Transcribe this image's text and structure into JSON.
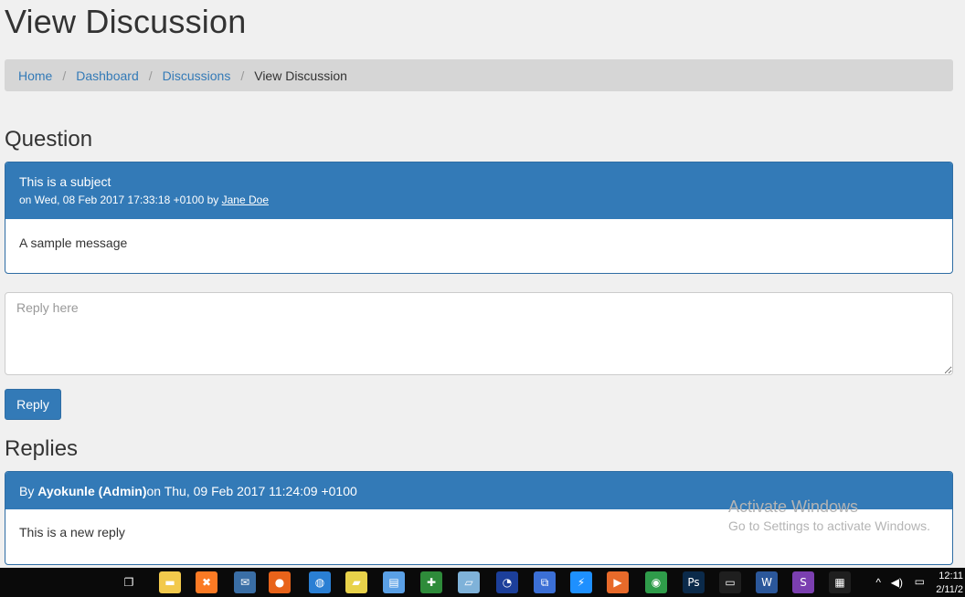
{
  "page": {
    "title": "View Discussion"
  },
  "breadcrumb": {
    "items": [
      {
        "label": "Home"
      },
      {
        "label": "Dashboard"
      },
      {
        "label": "Discussions"
      }
    ],
    "separator": "/",
    "active": "View Discussion"
  },
  "question": {
    "heading": "Question",
    "subject": "This is a subject",
    "meta_prefix": "on Wed, 08 Feb 2017 17:33:18 +0100 by ",
    "author": "Jane Doe",
    "message": "A sample message"
  },
  "reply_form": {
    "placeholder": "Reply here",
    "button_label": "Reply"
  },
  "replies": {
    "heading": "Replies",
    "items": [
      {
        "by_label": "By ",
        "author": "Ayokunle (Admin)",
        "date_text": " on Thu, 09 Feb 2017 11:24:09 +0100",
        "message": "This is a new reply"
      }
    ]
  },
  "watermark": {
    "line1": "Activate Windows",
    "line2": "Go to Settings to activate Windows."
  },
  "taskbar": {
    "icons": [
      {
        "name": "task-view-icon",
        "color": "#0a0a0a",
        "glyph": "❐"
      },
      {
        "name": "file-explorer-icon",
        "color": "#f2c94c",
        "glyph": "▬"
      },
      {
        "name": "xampp-icon",
        "color": "#fb7a24",
        "glyph": "✖"
      },
      {
        "name": "thunderbird-icon",
        "color": "#3a6ea5",
        "glyph": "✉"
      },
      {
        "name": "firefox-icon",
        "color": "#e8631a",
        "glyph": "●"
      },
      {
        "name": "globe-icon",
        "color": "#2a7fd4",
        "glyph": "◍"
      },
      {
        "name": "notes-icon",
        "color": "#e8d24a",
        "glyph": "▰"
      },
      {
        "name": "notepad-icon",
        "color": "#5aa0e6",
        "glyph": "▤"
      },
      {
        "name": "add-on-icon",
        "color": "#2e8b3a",
        "glyph": "✚"
      },
      {
        "name": "book-icon",
        "color": "#7fb2d9",
        "glyph": "▱"
      },
      {
        "name": "compass-icon",
        "color": "#1c3f9a",
        "glyph": "◔"
      },
      {
        "name": "network-icon",
        "color": "#3b6fd6",
        "glyph": "⧉"
      },
      {
        "name": "lightning-icon",
        "color": "#1e90ff",
        "glyph": "⚡"
      },
      {
        "name": "media-player-icon",
        "color": "#e86a2a",
        "glyph": "▶"
      },
      {
        "name": "chrome-icon",
        "color": "#2f9c4a",
        "glyph": "◉"
      },
      {
        "name": "photoshop-icon",
        "color": "#0b2a4a",
        "glyph": "Ps"
      },
      {
        "name": "terminal-icon",
        "color": "#1f1f1f",
        "glyph": "▭"
      },
      {
        "name": "word-icon",
        "color": "#2b579a",
        "glyph": "W"
      },
      {
        "name": "php-icon",
        "color": "#7b3fb0",
        "glyph": "S"
      },
      {
        "name": "calculator-icon",
        "color": "#1f1f1f",
        "glyph": "▦"
      }
    ],
    "time": "12:11",
    "date": "2/11/2"
  }
}
